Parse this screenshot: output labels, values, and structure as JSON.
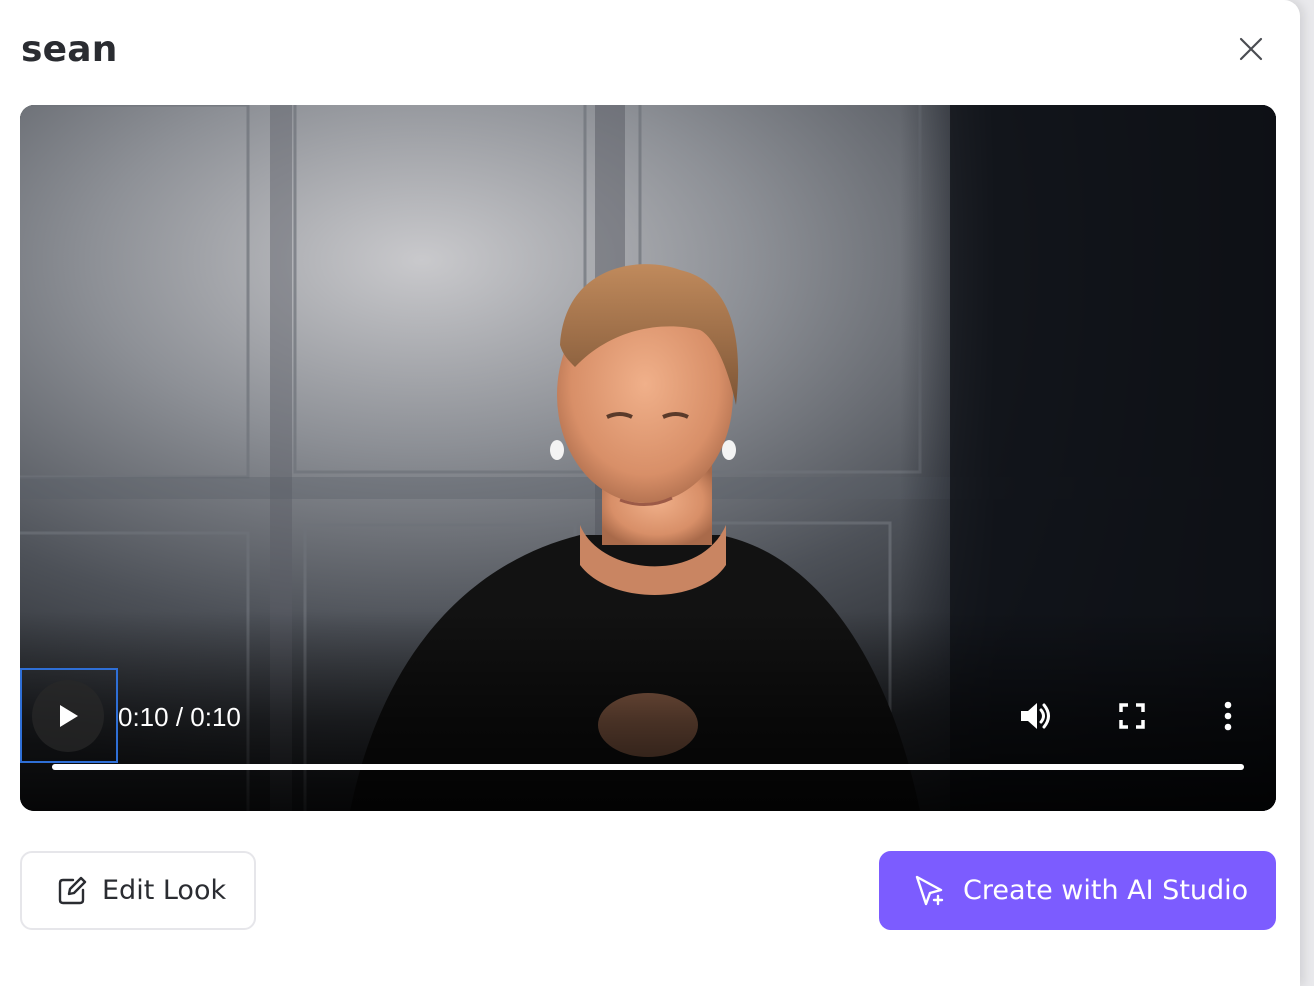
{
  "dialog": {
    "title": "sean"
  },
  "video": {
    "time_display": "0:10 / 0:10",
    "progress_fraction": 1.0,
    "state": "paused"
  },
  "actions": {
    "edit_label": "Edit Look",
    "studio_label": "Create with AI Studio"
  },
  "icons": {
    "close": "close-icon",
    "play": "play-icon",
    "volume": "volume-icon",
    "fullscreen": "fullscreen-icon",
    "more": "more-vertical-icon",
    "edit": "edit-icon",
    "studio": "cursor-plus-icon"
  },
  "colors": {
    "accent": "#7c5cff",
    "focus_ring": "#2f6fd6",
    "title_text": "#2a2c31"
  }
}
